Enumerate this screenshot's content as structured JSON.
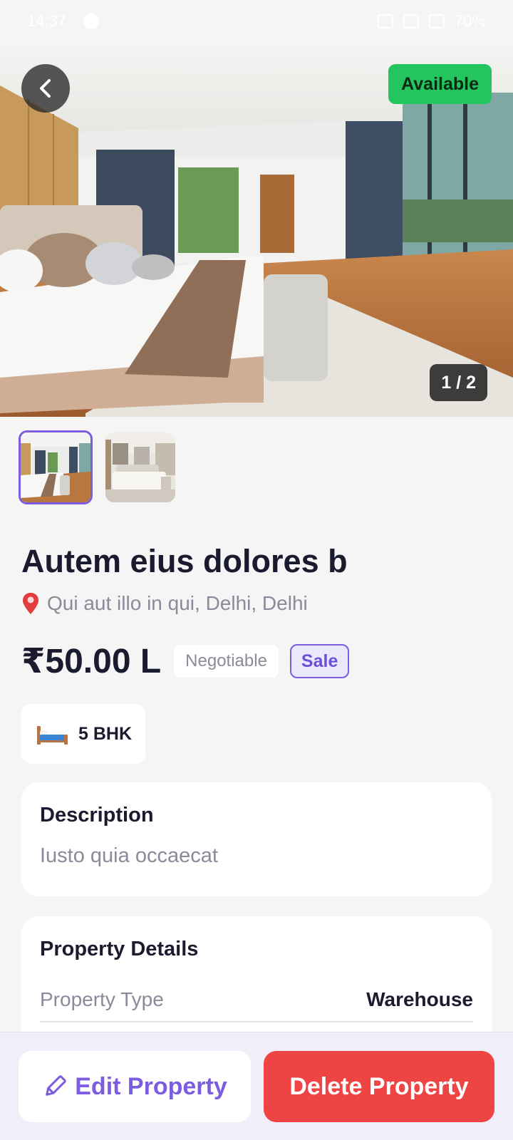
{
  "status_bar": {
    "time": "14:37",
    "battery": "70%"
  },
  "hero": {
    "availability": "Available",
    "image_counter": "1 / 2"
  },
  "thumbnails": [
    {
      "icon": "bedroom-photo-1",
      "selected": true
    },
    {
      "icon": "bedroom-photo-2",
      "selected": false
    }
  ],
  "property": {
    "title": "Autem eius dolores b",
    "location": "Qui aut illo in qui, Delhi, Delhi",
    "price": "₹50.00 L",
    "negotiable": "Negotiable",
    "listing_type": "Sale",
    "bhk": "5 BHK"
  },
  "description": {
    "heading": "Description",
    "text": "Iusto quia occaecat"
  },
  "details": {
    "heading": "Property Details",
    "rows": [
      {
        "key": "Property Type",
        "value": "Warehouse"
      }
    ]
  },
  "actions": {
    "edit_label": "Edit Property",
    "delete_label": "Delete Property"
  },
  "colors": {
    "accent": "#7c5ce0",
    "available": "#22c55e",
    "danger": "#ef4444"
  }
}
